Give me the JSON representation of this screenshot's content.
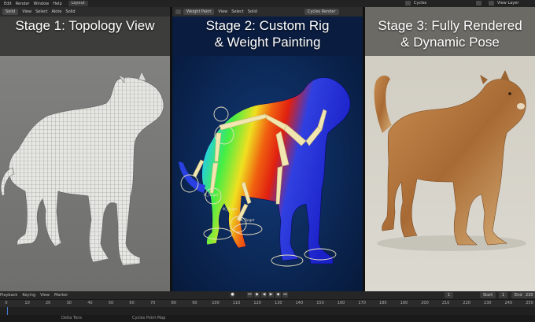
{
  "menu": {
    "items": [
      "Edit",
      "Render",
      "Window",
      "Help"
    ],
    "workspace_tab": "Layout",
    "render_engine": "Cycles",
    "view_layer": "View Layer"
  },
  "panels": [
    {
      "header": {
        "mode": "Solid",
        "items": [
          "View",
          "Select",
          "Alote",
          "Solid"
        ]
      },
      "title_line1": "Stage 1: Topology View",
      "title_line2": ""
    },
    {
      "header": {
        "mode": "Weight Paint",
        "items": [
          "View",
          "Select",
          "Solid"
        ],
        "render_label": "Cycles Render"
      },
      "title_line1": "Stage 2: Custom Rig",
      "title_line2": "& Weight Painting",
      "bone_labels": [
        "IK_Target",
        "IK_Target",
        "IK_Target"
      ]
    },
    {
      "header": {
        "mode": "",
        "items": []
      },
      "title_line1": "Stage 3: Fully Rendered",
      "title_line2": "& Dynamic Pose"
    }
  ],
  "timeline": {
    "menu": [
      "Playback",
      "Keying",
      "View",
      "Marker"
    ],
    "current_frame": "1",
    "start_label": "Start",
    "start_value": "1",
    "end_label": "End",
    "end_value": "230",
    "ticks": [
      "0",
      "10",
      "20",
      "30",
      "40",
      "50",
      "60",
      "70",
      "80",
      "90",
      "100",
      "110",
      "120",
      "130",
      "140",
      "150",
      "160",
      "170",
      "180",
      "190",
      "200",
      "210",
      "220",
      "230",
      "240",
      "250"
    ]
  },
  "status": {
    "item1": "Delta Tons",
    "item2": "Cycles Point Map"
  },
  "colors": {
    "viewport_gray": "#7a7a78",
    "weight_bg": "#0b2350",
    "render_bg": "#d6d3ca",
    "bone": "#f2e6b0"
  }
}
